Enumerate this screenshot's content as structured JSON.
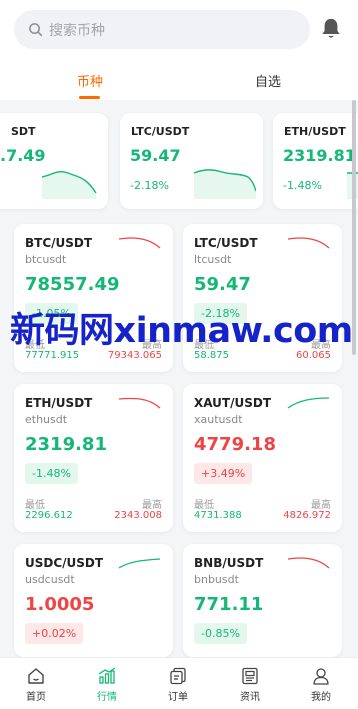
{
  "search": {
    "placeholder": "搜索币种",
    "icon": "search-icon"
  },
  "header": {
    "bell_icon": "bell-icon"
  },
  "tabs": [
    {
      "label": "币种",
      "active": true
    },
    {
      "label": "自选",
      "active": false
    }
  ],
  "mini_cards": [
    {
      "pair": "SDT",
      "price": ".7.49",
      "change": "",
      "color": "#14b876"
    },
    {
      "pair": "LTC/USDT",
      "price": "59.47",
      "change": "-2.18%",
      "color": "#14b876"
    },
    {
      "pair": "ETH/USDT",
      "price": "2319.81",
      "change": "-1.48%",
      "color": "#14b876"
    }
  ],
  "cards": [
    {
      "pair": "BTC/USDT",
      "symbol": "btcusdt",
      "price": "78557.49",
      "change": "-1.05%",
      "trend": "down",
      "low_label": "最低",
      "high_label": "最高",
      "low": "77771.915",
      "high": "79343.065"
    },
    {
      "pair": "LTC/USDT",
      "symbol": "ltcusdt",
      "price": "59.47",
      "change": "-2.18%",
      "trend": "down",
      "low_label": "最低",
      "high_label": "最高",
      "low": "58.875",
      "high": "60.065"
    },
    {
      "pair": "ETH/USDT",
      "symbol": "ethusdt",
      "price": "2319.81",
      "change": "-1.48%",
      "trend": "down",
      "low_label": "最低",
      "high_label": "最高",
      "low": "2296.612",
      "high": "2343.008"
    },
    {
      "pair": "XAUT/USDT",
      "symbol": "xautusdt",
      "price": "4779.18",
      "change": "+3.49%",
      "trend": "up",
      "low_label": "最低",
      "high_label": "最高",
      "low": "4731.388",
      "high": "4826.972"
    },
    {
      "pair": "USDC/USDT",
      "symbol": "usdcusdt",
      "price": "1.0005",
      "change": "+0.02%",
      "trend": "up"
    },
    {
      "pair": "BNB/USDT",
      "symbol": "bnbusdt",
      "price": "771.11",
      "change": "-0.85%",
      "trend": "down"
    }
  ],
  "watermark": "新码网xinmaw.com",
  "tabbar": [
    {
      "label": "首页",
      "icon": "home-icon",
      "active": false
    },
    {
      "label": "行情",
      "icon": "market-chart-icon",
      "active": true
    },
    {
      "label": "订单",
      "icon": "order-icon",
      "active": false
    },
    {
      "label": "资讯",
      "icon": "news-icon",
      "active": false
    },
    {
      "label": "我的",
      "icon": "profile-icon",
      "active": false
    }
  ],
  "colors": {
    "up": "#14b876",
    "down": "#ef4444",
    "accent": "#ff6a00"
  }
}
